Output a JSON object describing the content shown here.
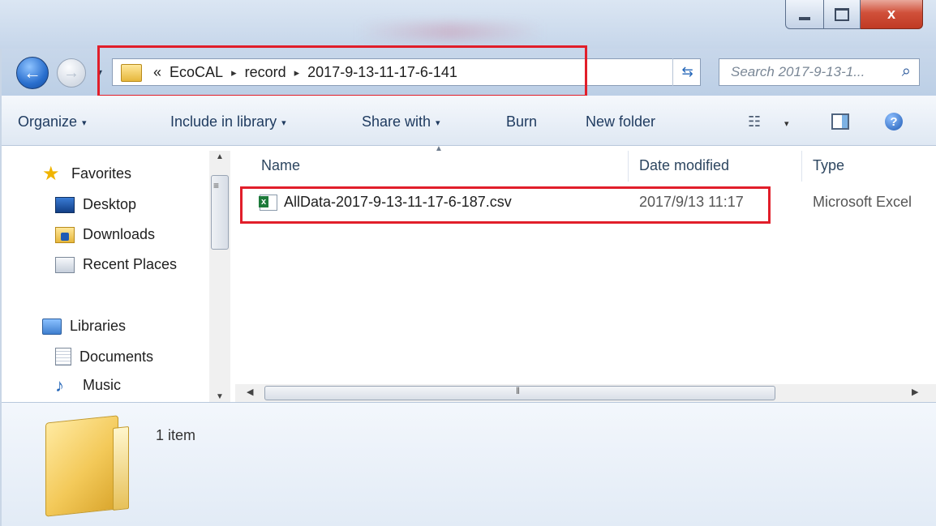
{
  "window": {
    "caption": {
      "minimize": "",
      "maximize": "",
      "close": "x"
    }
  },
  "nav": {
    "back_glyph": "←",
    "forward_glyph": "→",
    "recent_glyph": "▾"
  },
  "address": {
    "overflow": "«",
    "crumbs": [
      "EcoCAL",
      "record",
      "2017-9-13-11-17-6-141"
    ],
    "separator": "▸",
    "dropdown_glyph": "▾",
    "refresh_glyph": "⇆"
  },
  "search": {
    "placeholder": "Search 2017-9-13-1...",
    "icon": "search-icon"
  },
  "commandbar": {
    "organize": "Organize",
    "include_in_library": "Include in library",
    "share_with": "Share with",
    "burn": "Burn",
    "new_folder": "New folder",
    "dropdown_glyph": "▾"
  },
  "navpane": {
    "favorites": "Favorites",
    "desktop": "Desktop",
    "downloads": "Downloads",
    "recent_places": "Recent Places",
    "libraries": "Libraries",
    "documents": "Documents",
    "music": "Music"
  },
  "columns": {
    "name": "Name",
    "date_modified": "Date modified",
    "type": "Type"
  },
  "files": [
    {
      "name": "AllData-2017-9-13-11-17-6-187.csv",
      "date_modified": "2017/9/13 11:17",
      "type": "Microsoft Excel"
    }
  ],
  "details": {
    "item_count": "1 item"
  },
  "colors": {
    "highlight": "#e11e2a",
    "accent": "#2466b8"
  }
}
